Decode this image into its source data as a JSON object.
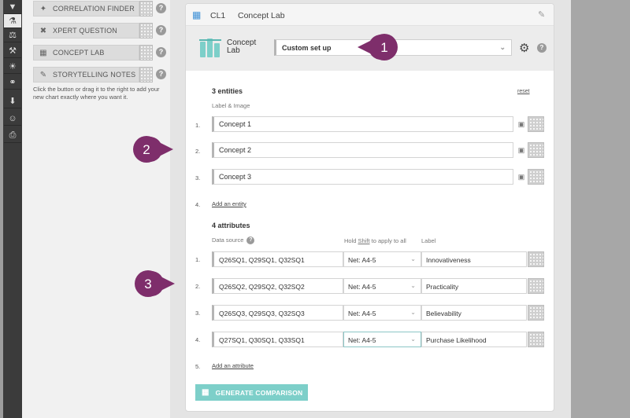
{
  "sidebar": {
    "items": [
      {
        "label": "CORRELATION FINDER",
        "icon": "correlation-icon"
      },
      {
        "label": "XPERT QUESTION",
        "icon": "xpert-icon"
      },
      {
        "label": "CONCEPT LAB",
        "icon": "concept-lab-icon"
      },
      {
        "label": "STORYTELLING NOTES",
        "icon": "notes-icon"
      }
    ],
    "hint": "Click the button or drag it to the right to add your new chart exactly where you want it."
  },
  "card": {
    "id": "CL1",
    "title": "Concept Lab",
    "logo_line1": "Concept",
    "logo_line2": "Lab",
    "setup_select": "Custom set up",
    "entities": {
      "title": "3 entities",
      "reset": "reset",
      "sub": "Label & Image",
      "nums": [
        "1.",
        "2.",
        "3.",
        "4."
      ],
      "rows": [
        "Concept 1",
        "Concept 2",
        "Concept 3"
      ],
      "add": "Add an entity"
    },
    "attributes": {
      "title": "4 attributes",
      "col_source": "Data source",
      "col_hold_pre": "Hold ",
      "col_hold_key": "Shift",
      "col_hold_post": " to apply to all",
      "col_label": "Label",
      "nums": [
        "1.",
        "2.",
        "3.",
        "4.",
        "5."
      ],
      "rows": [
        {
          "source": "Q26SQ1, Q29SQ1, Q32SQ1",
          "net": "Net: A4-5",
          "label": "Innovativeness"
        },
        {
          "source": "Q26SQ2, Q29SQ2, Q32SQ2",
          "net": "Net: A4-5",
          "label": "Practicality"
        },
        {
          "source": "Q26SQ3, Q29SQ3, Q32SQ3",
          "net": "Net: A4-5",
          "label": "Believability"
        },
        {
          "source": "Q27SQ1, Q30SQ1, Q33SQ1",
          "net": "Net: A4-5",
          "label": "Purchase Likelihood"
        }
      ],
      "add": "Add an attribute"
    },
    "generate": "GENERATE COMPARISON"
  },
  "callouts": [
    "1",
    "2",
    "3"
  ],
  "colors": {
    "accent": "#7dcfc9",
    "callout": "#7e2e6b",
    "iconbar": "#3b3b3b"
  }
}
